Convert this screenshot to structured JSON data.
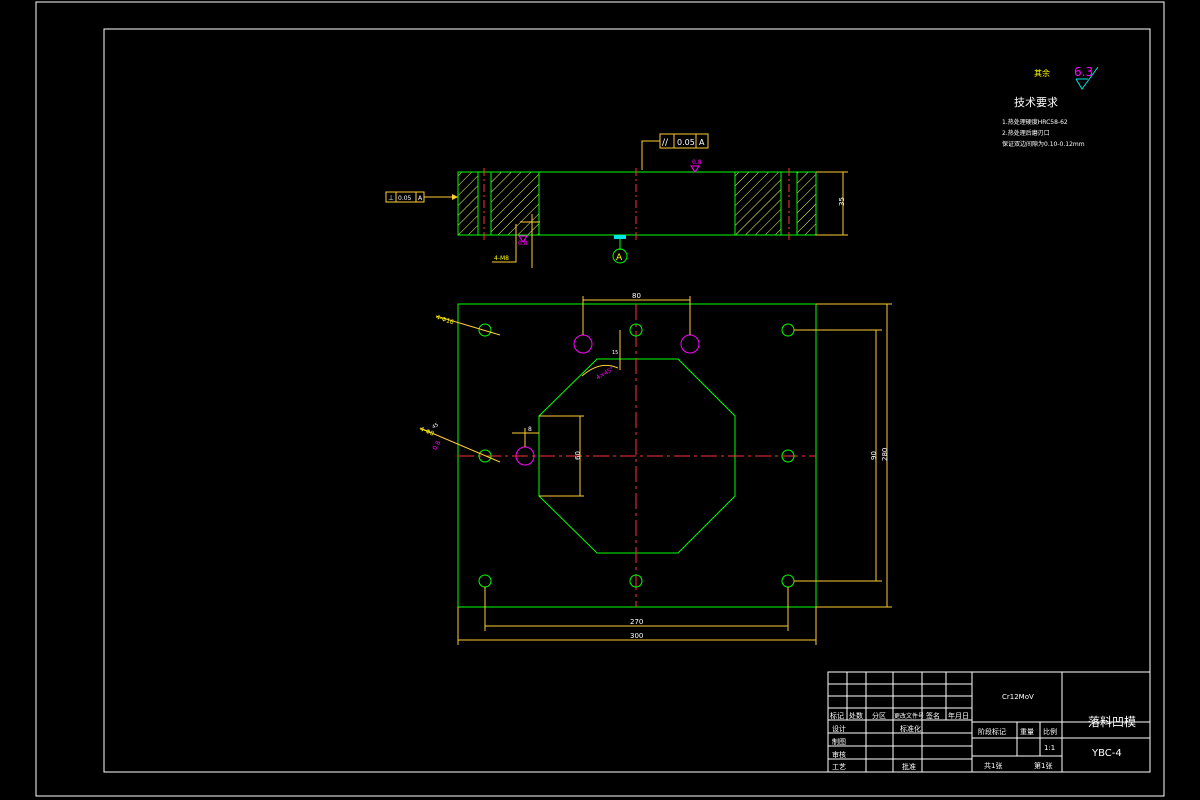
{
  "colors": {
    "background": "#000000",
    "frame": "#ffffff",
    "outline": "#00ff00",
    "dimension": "#ffcc33",
    "centerline": "#ff3333",
    "hole": "#ff00ff",
    "hatch": "#ffff66",
    "datum": "#00e5e5"
  },
  "tech": {
    "roughness_prefix": "其余",
    "roughness_value": "6.3",
    "heading": "技术要求",
    "line1": "1.热处理硬度HRC58-62",
    "line2": "2.热处理后磨刃口",
    "line3": "保证双边间隙为0.10-0.12mm"
  },
  "section": {
    "parallel_symbol": "//",
    "parallel_tol": "0.05",
    "parallel_datum": "A",
    "perp_symbol": "⊥",
    "perp_tol": "0.05",
    "perp_datum": "A",
    "rough_top": "0.8",
    "rough_inner": "0.8",
    "height_dim": "35",
    "bolt_dim": "4-M8",
    "datum_label": "A"
  },
  "plan": {
    "dim_top": "80",
    "dim_pitch": "90",
    "dim_height": "280",
    "dim_pitch_h": "270",
    "dim_width": "300",
    "dim_inner_h": "60",
    "dim_small": "8",
    "dim_cham": "15",
    "chamfer_note": "4×45°",
    "hole_note_left": "4-Φ16",
    "hole_note_left2": "4-Φ8",
    "rough_left": "0.8",
    "dim_45": "45"
  },
  "title_block": {
    "material": "Cr12MoV",
    "part_name": "落料凹模",
    "drawing_no": "YBC-4",
    "scale": "1:1",
    "headers": [
      "标记",
      "处数",
      "分区",
      "更改文件号",
      "签名",
      "年月日"
    ],
    "row_design": "设计",
    "row_standard": "标准化",
    "row_draw": "制图",
    "row_review": "审核",
    "row_process": "工艺",
    "row_approve": "批准",
    "stage_label": "阶段标记",
    "weight_label": "重量",
    "scale_label": "比例",
    "sheets_total": "共1张",
    "sheet_no": "第1张"
  }
}
